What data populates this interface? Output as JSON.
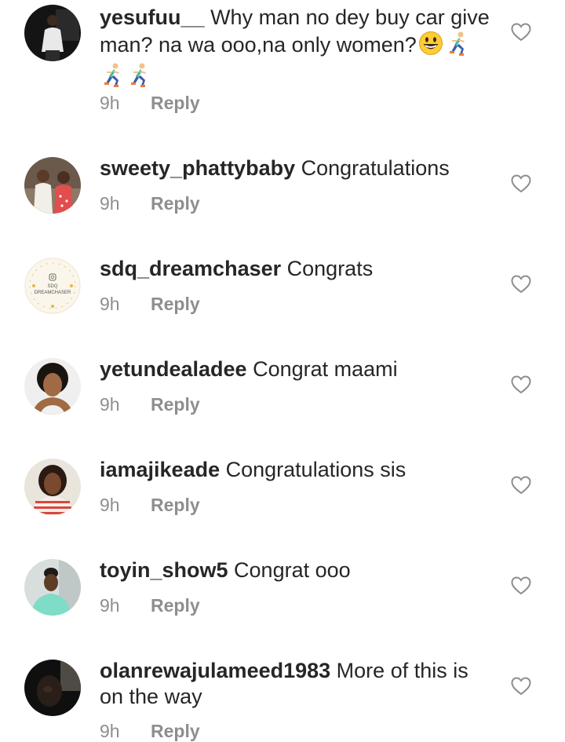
{
  "comments": [
    {
      "username": "yesufuu__",
      "text": "Why man no dey buy car give man? na wa ooo,na only women?",
      "emoji_icons": [
        "grinning-face-icon",
        "person-running-icon",
        "person-running-icon",
        "person-running-icon"
      ],
      "time": "9h",
      "reply_label": "Reply"
    },
    {
      "username": "sweety_phattybaby",
      "text": "Congratulations",
      "time": "9h",
      "reply_label": "Reply"
    },
    {
      "username": "sdq_dreamchaser",
      "text": "Congrats",
      "avatar_text": [
        "SDQ",
        "DREAMCHASER"
      ],
      "time": "9h",
      "reply_label": "Reply"
    },
    {
      "username": "yetundealadee",
      "text": "Congrat maami",
      "time": "9h",
      "reply_label": "Reply"
    },
    {
      "username": "iamajikeade",
      "text": "Congratulations sis",
      "time": "9h",
      "reply_label": "Reply"
    },
    {
      "username": "toyin_show5",
      "text": "Congrat ooo",
      "time": "9h",
      "reply_label": "Reply"
    },
    {
      "username": "olanrewajulameed1983",
      "text": "More of this is on the way",
      "time": "9h",
      "reply_label": "Reply"
    }
  ],
  "colors": {
    "text": "#262626",
    "meta": "#8e8e8e",
    "icon_outline": "#8e8e8e",
    "background": "#ffffff"
  },
  "icons": {
    "like": "heart-outline-icon"
  }
}
